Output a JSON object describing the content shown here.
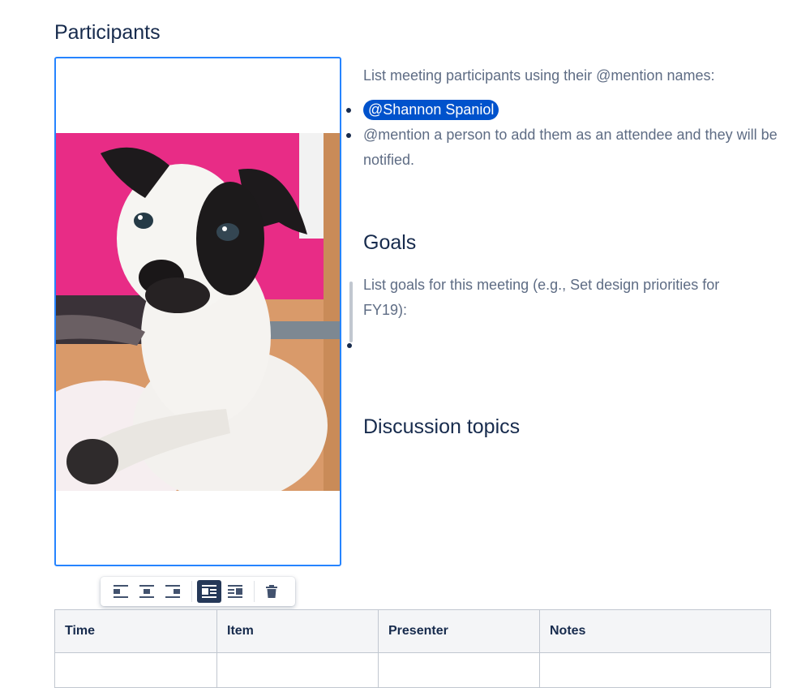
{
  "sections": {
    "participants_heading": "Participants",
    "goals_heading": "Goals",
    "discussion_heading": "Discussion topics"
  },
  "participants": {
    "intro": "List meeting participants using their @mention names:",
    "mention": "@Shannon Spaniol",
    "hint": "@mention a person to add them as an attendee and they will be notified."
  },
  "goals": {
    "intro": "List goals for this meeting (e.g., Set design priorities for FY19):"
  },
  "image_toolbar": {
    "buttons": [
      "align-left-icon",
      "align-center-icon",
      "align-right-icon",
      "wrap-left-icon",
      "wrap-right-icon",
      "trash-icon"
    ],
    "active": "wrap-left-icon"
  },
  "table": {
    "headers": [
      "Time",
      "Item",
      "Presenter",
      "Notes"
    ]
  },
  "colors": {
    "accent": "#2684ff",
    "mention_bg": "#0052cc",
    "toolbar_active": "#253858"
  }
}
